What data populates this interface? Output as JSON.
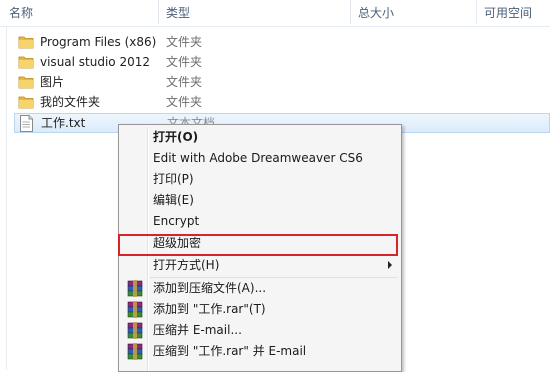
{
  "header": {
    "col_name": "名称",
    "col_type": "类型",
    "col_total": "总大小",
    "col_free": "可用空间"
  },
  "files": [
    {
      "name": "Program Files (x86)",
      "type": "文件夹",
      "icon": "folder-icon"
    },
    {
      "name": "visual studio 2012",
      "type": "文件夹",
      "icon": "folder-icon"
    },
    {
      "name": "图片",
      "type": "文件夹",
      "icon": "folder-icon"
    },
    {
      "name": "我的文件夹",
      "type": "文件夹",
      "icon": "folder-icon"
    },
    {
      "name": "工作.txt",
      "type": "文本文档",
      "icon": "text-file-icon",
      "selected": true
    }
  ],
  "context_menu": {
    "items": [
      {
        "label": "打开(O)",
        "bold": true
      },
      {
        "label": "Edit with Adobe Dreamweaver CS6"
      },
      {
        "label": "打印(P)"
      },
      {
        "label": "编辑(E)"
      },
      {
        "label": "Encrypt"
      },
      {
        "label": "超级加密",
        "highlighted": true
      },
      {
        "label": "打开方式(H)",
        "submenu": true
      },
      {
        "label": "添加到压缩文件(A)...",
        "icon": "winrar-icon"
      },
      {
        "label": "添加到 \"工作.rar\"(T)",
        "icon": "winrar-icon"
      },
      {
        "label": "压缩并 E-mail...",
        "icon": "winrar-icon"
      },
      {
        "label": "压缩到 \"工作.rar\" 并 E-mail",
        "icon": "winrar-icon"
      }
    ]
  },
  "colors": {
    "highlight_border": "#d6242a",
    "selection": "#dcebfb",
    "header_text": "#4c607a"
  }
}
